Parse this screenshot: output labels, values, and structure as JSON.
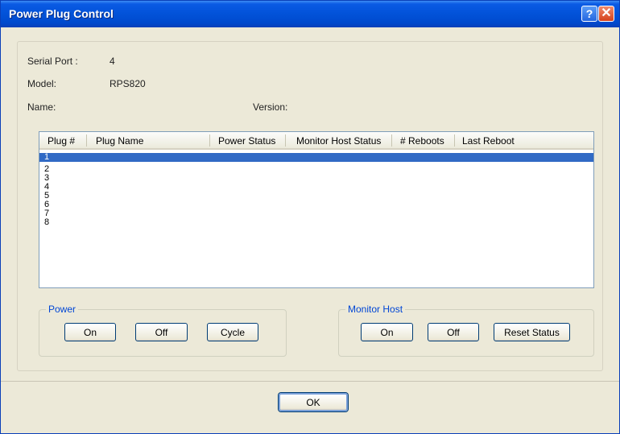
{
  "window": {
    "title": "Power Plug Control",
    "help_glyph": "?",
    "close_glyph": "✕"
  },
  "info": {
    "serial_port_label": "Serial Port :",
    "serial_port_value": "4",
    "model_label": "Model:",
    "model_value": "RPS820",
    "name_label": "Name:",
    "version_label": "Version:"
  },
  "list": {
    "columns": [
      "Plug #",
      "Plug Name",
      "Power Status",
      "Monitor Host Status",
      "# Reboots",
      "Last Reboot"
    ],
    "rows": [
      "1",
      "2",
      "3",
      "4",
      "5",
      "6",
      "7",
      "8"
    ],
    "selected_index": 0
  },
  "power_group": {
    "label": "Power",
    "on_label": "On",
    "off_label": "Off",
    "cycle_label": "Cycle"
  },
  "monitor_group": {
    "label": "Monitor Host",
    "on_label": "On",
    "off_label": "Off",
    "reset_label": "Reset Status"
  },
  "footer": {
    "ok_label": "OK"
  },
  "colors": {
    "titlebar": "#0252d8",
    "selection": "#316ac5",
    "group_label": "#0046d5",
    "dialog_bg": "#ece9d8"
  },
  "icons": {
    "help": "help-icon",
    "close": "close-icon"
  }
}
